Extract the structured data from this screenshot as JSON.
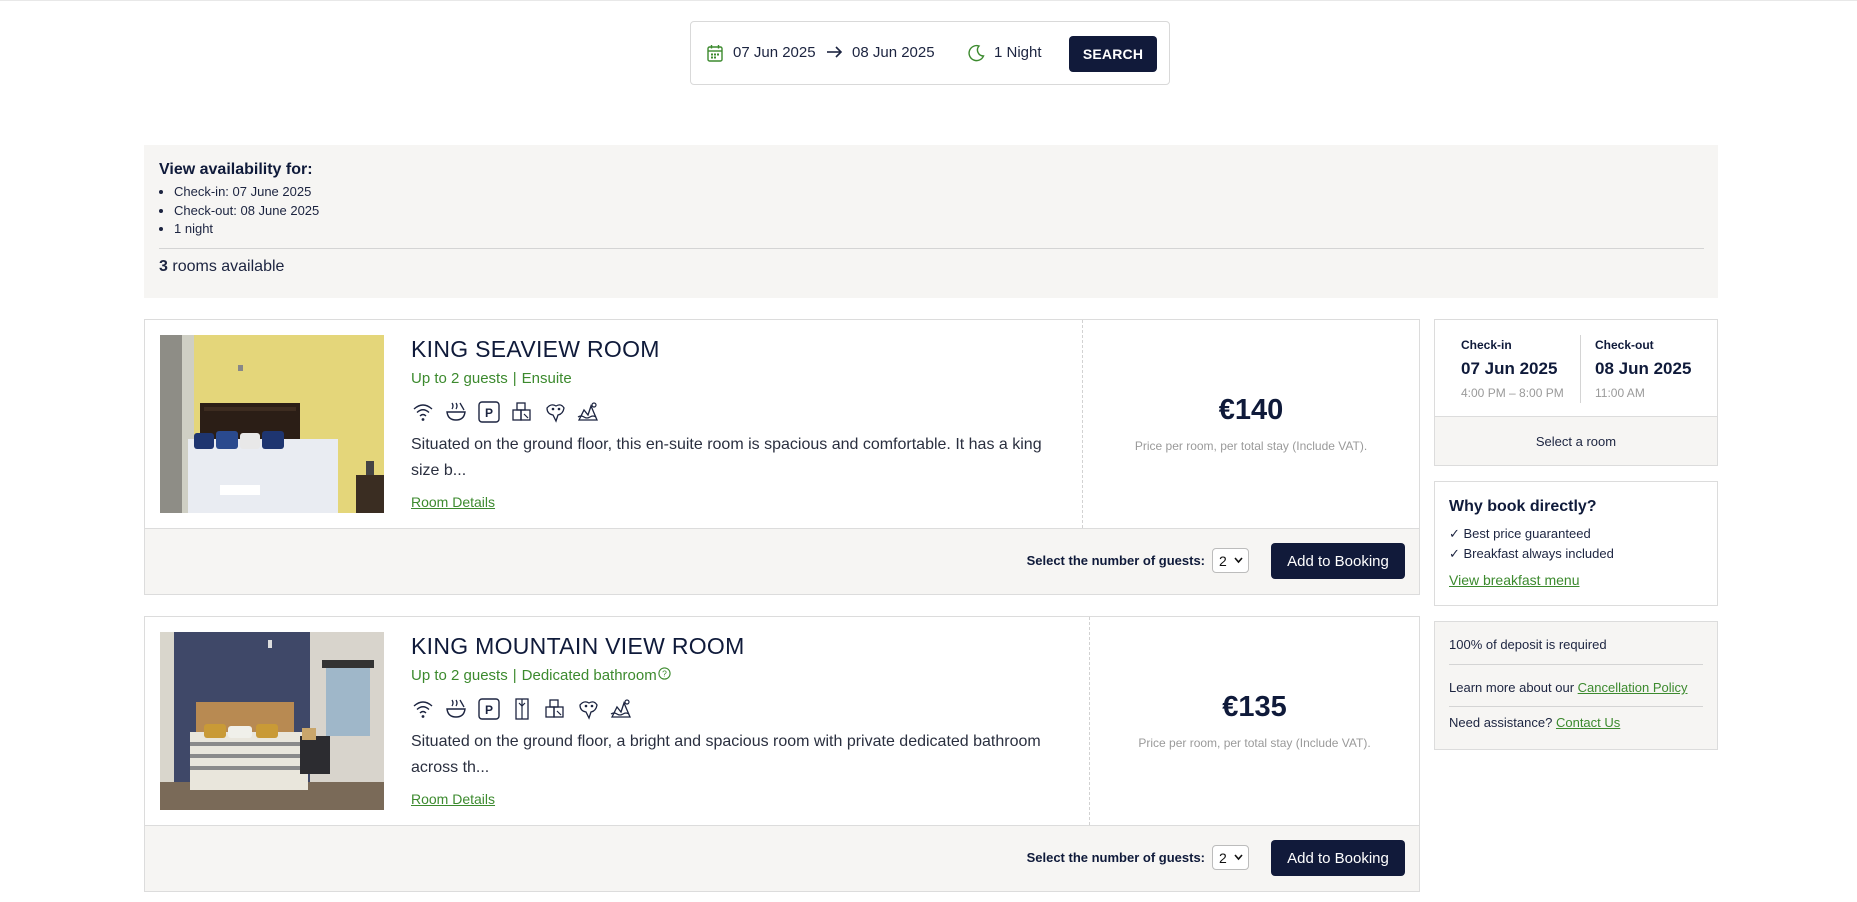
{
  "search": {
    "checkin": "07 Jun 2025",
    "checkout": "08 Jun 2025",
    "nights": "1 Night",
    "button": "SEARCH"
  },
  "availability": {
    "title": "View availability for:",
    "items": [
      "Check-in: 07 June 2025",
      "Check-out: 08 June 2025",
      "1 night"
    ],
    "count": "3",
    "count_text": "rooms available"
  },
  "rooms": [
    {
      "title": "KING SEAVIEW ROOM",
      "guests": "Up to 2 guests",
      "feature": "Ensuite",
      "icons": [
        "wifi-icon",
        "breakfast-icon",
        "parking-icon",
        "iron-icon",
        "toiletries-icon",
        "sea-view-icon"
      ],
      "description": "Situated on the ground floor, this en-suite room is spacious and comfortable. It has a king size b...",
      "details_link": "Room Details",
      "price": "€140",
      "price_note": "Price per room, per total stay (Include VAT).",
      "guests_label": "Select the number of guests:",
      "guests_value": "2",
      "add_button": "Add to Booking"
    },
    {
      "title": "KING MOUNTAIN VIEW ROOM",
      "guests": "Up to 2 guests",
      "feature": "Dedicated bathroom",
      "icons": [
        "wifi-icon",
        "breakfast-icon",
        "parking-icon",
        "wardrobe-icon",
        "iron-icon",
        "toiletries-icon",
        "mountain-view-icon"
      ],
      "description": "Situated on the ground floor, a bright and spacious room with private dedicated bathroom across th...",
      "details_link": "Room Details",
      "price": "€135",
      "price_note": "Price per room, per total stay (Include VAT).",
      "guests_label": "Select the number of guests:",
      "guests_value": "2",
      "add_button": "Add to Booking"
    }
  ],
  "sidebar": {
    "checkin_label": "Check-in",
    "checkin_date": "07 Jun 2025",
    "checkin_time": "4:00 PM – 8:00 PM",
    "checkout_label": "Check-out",
    "checkout_date": "08 Jun 2025",
    "checkout_time": "11:00 AM",
    "select_room": "Select a room",
    "why_title": "Why book directly?",
    "why_items": [
      "✓ Best price guaranteed",
      "✓ Breakfast always included"
    ],
    "breakfast_link": "View breakfast menu",
    "deposit": "100% of deposit is required",
    "cancellation_prefix": "Learn more about our",
    "cancellation_link": "Cancellation Policy",
    "assist_prefix": "Need assistance?",
    "contact_link": "Contact Us"
  },
  "colors": {
    "navy": "#111a3a",
    "green": "#3c8a2e",
    "panel": "#f6f5f3"
  }
}
